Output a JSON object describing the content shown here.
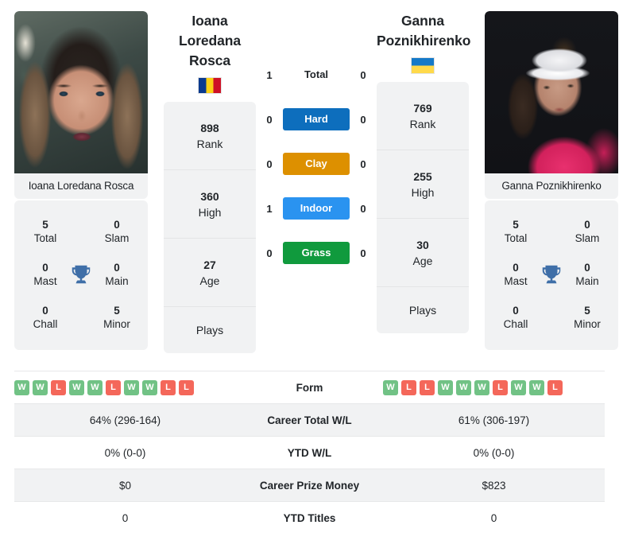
{
  "players": {
    "left": {
      "display_name": "Ioana Loredana Rosca",
      "name_lines": [
        "Ioana",
        "Loredana",
        "Rosca"
      ],
      "flag": "flag-romania",
      "photo_caption": "Ioana Loredana Rosca",
      "titles": {
        "total_value": "5",
        "total_label": "Total",
        "slam_value": "0",
        "slam_label": "Slam",
        "mast_value": "0",
        "mast_label": "Mast",
        "main_value": "0",
        "main_label": "Main",
        "chall_value": "0",
        "chall_label": "Chall",
        "minor_value": "5",
        "minor_label": "Minor",
        "icon": "trophy-icon"
      },
      "info": {
        "rank_value": "898",
        "rank_label": "Rank",
        "high_value": "360",
        "high_label": "High",
        "age_value": "27",
        "age_label": "Age",
        "plays_label": "Plays",
        "plays_value": ""
      },
      "form": [
        "W",
        "W",
        "L",
        "W",
        "W",
        "L",
        "W",
        "W",
        "L",
        "L"
      ],
      "career_total_wl": "64% (296-164)",
      "ytd_wl": "0% (0-0)",
      "career_prize_money": "$0",
      "ytd_titles": "0"
    },
    "right": {
      "display_name": "Ganna Poznikhirenko",
      "name_lines": [
        "Ganna",
        "Poznikhirenko"
      ],
      "flag": "flag-ukraine",
      "photo_caption": "Ganna Poznikhirenko",
      "titles": {
        "total_value": "5",
        "total_label": "Total",
        "slam_value": "0",
        "slam_label": "Slam",
        "mast_value": "0",
        "mast_label": "Mast",
        "main_value": "0",
        "main_label": "Main",
        "chall_value": "0",
        "chall_label": "Chall",
        "minor_value": "5",
        "minor_label": "Minor",
        "icon": "trophy-icon"
      },
      "info": {
        "rank_value": "769",
        "rank_label": "Rank",
        "high_value": "255",
        "high_label": "High",
        "age_value": "30",
        "age_label": "Age",
        "plays_label": "Plays",
        "plays_value": ""
      },
      "form": [
        "W",
        "L",
        "L",
        "W",
        "W",
        "W",
        "L",
        "W",
        "W",
        "L"
      ],
      "career_total_wl": "61% (306-197)",
      "ytd_wl": "0% (0-0)",
      "career_prize_money": "$823",
      "ytd_titles": "0"
    }
  },
  "h2h": {
    "rows": [
      {
        "label": "Total",
        "left": "1",
        "right": "0",
        "color": "",
        "style": "plain"
      },
      {
        "label": "Hard",
        "left": "0",
        "right": "0",
        "color": "#0d6ebd",
        "style": "badge"
      },
      {
        "label": "Clay",
        "left": "0",
        "right": "0",
        "color": "#dd9000",
        "style": "badge"
      },
      {
        "label": "Indoor",
        "left": "1",
        "right": "0",
        "color": "#2a93f0",
        "style": "badge"
      },
      {
        "label": "Grass",
        "left": "0",
        "right": "0",
        "color": "#109a3d",
        "style": "badge"
      }
    ]
  },
  "table": {
    "rows": [
      {
        "label": "Form",
        "kind": "form"
      },
      {
        "label": "Career Total W/L",
        "kind": "text",
        "left": "64% (296-164)",
        "right": "61% (306-197)"
      },
      {
        "label": "YTD W/L",
        "kind": "text",
        "left": "0% (0-0)",
        "right": "0% (0-0)"
      },
      {
        "label": "Career Prize Money",
        "kind": "text",
        "left": "$0",
        "right": "$823"
      },
      {
        "label": "YTD Titles",
        "kind": "text",
        "left": "0",
        "right": "0"
      }
    ]
  },
  "colors": {
    "hard": "#0d6ebd",
    "clay": "#dd9000",
    "indoor": "#2a93f0",
    "grass": "#109a3d",
    "win_badge": "#71c285",
    "loss_badge": "#f4675a",
    "card_bg": "#f1f2f3"
  }
}
